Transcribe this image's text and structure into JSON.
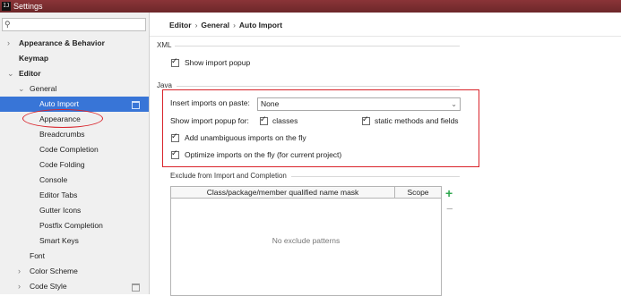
{
  "window": {
    "title": "Settings",
    "app_icon": "IJ"
  },
  "sidebar": {
    "search": {
      "value": "",
      "placeholder": ""
    },
    "items": [
      {
        "label": "Appearance & Behavior",
        "bold": true,
        "expander": "›"
      },
      {
        "label": "Keymap",
        "bold": true
      },
      {
        "label": "Editor",
        "bold": true,
        "expander": "⌄"
      },
      {
        "label": "General",
        "expander": "⌄"
      },
      {
        "label": "Auto Import",
        "selected": true
      },
      {
        "label": "Appearance"
      },
      {
        "label": "Breadcrumbs"
      },
      {
        "label": "Code Completion"
      },
      {
        "label": "Code Folding"
      },
      {
        "label": "Console"
      },
      {
        "label": "Editor Tabs"
      },
      {
        "label": "Gutter Icons"
      },
      {
        "label": "Postfix Completion"
      },
      {
        "label": "Smart Keys"
      },
      {
        "label": "Font"
      },
      {
        "label": "Color Scheme",
        "expander": "›"
      },
      {
        "label": "Code Style",
        "expander": "›"
      }
    ]
  },
  "breadcrumb": {
    "parts": [
      "Editor",
      "General",
      "Auto Import"
    ],
    "separator": "›"
  },
  "xml": {
    "heading": "XML",
    "show_import_popup": {
      "label": "Show import popup",
      "checked": true
    }
  },
  "java": {
    "heading": "Java",
    "insert_on_paste": {
      "label": "Insert imports on paste:",
      "value": "None"
    },
    "show_popup_for": {
      "label": "Show import popup for:",
      "classes": {
        "label": "classes",
        "checked": true
      },
      "static": {
        "label": "static methods and fields",
        "checked": true
      }
    },
    "add_unambiguous": {
      "label": "Add unambiguous imports on the fly",
      "checked": true
    },
    "optimize": {
      "label": "Optimize imports on the fly (for current project)",
      "checked": true
    }
  },
  "exclude": {
    "heading": "Exclude from Import and Completion",
    "columns": [
      "Class/package/member qualified name mask",
      "Scope"
    ],
    "empty_text": "No exclude patterns",
    "add_label": "+",
    "remove_label": "−"
  },
  "colors": {
    "selection": "#3875d7",
    "annotation": "#d9232a",
    "add_green": "#2fa84f",
    "titlebar": "#7c2e31"
  }
}
